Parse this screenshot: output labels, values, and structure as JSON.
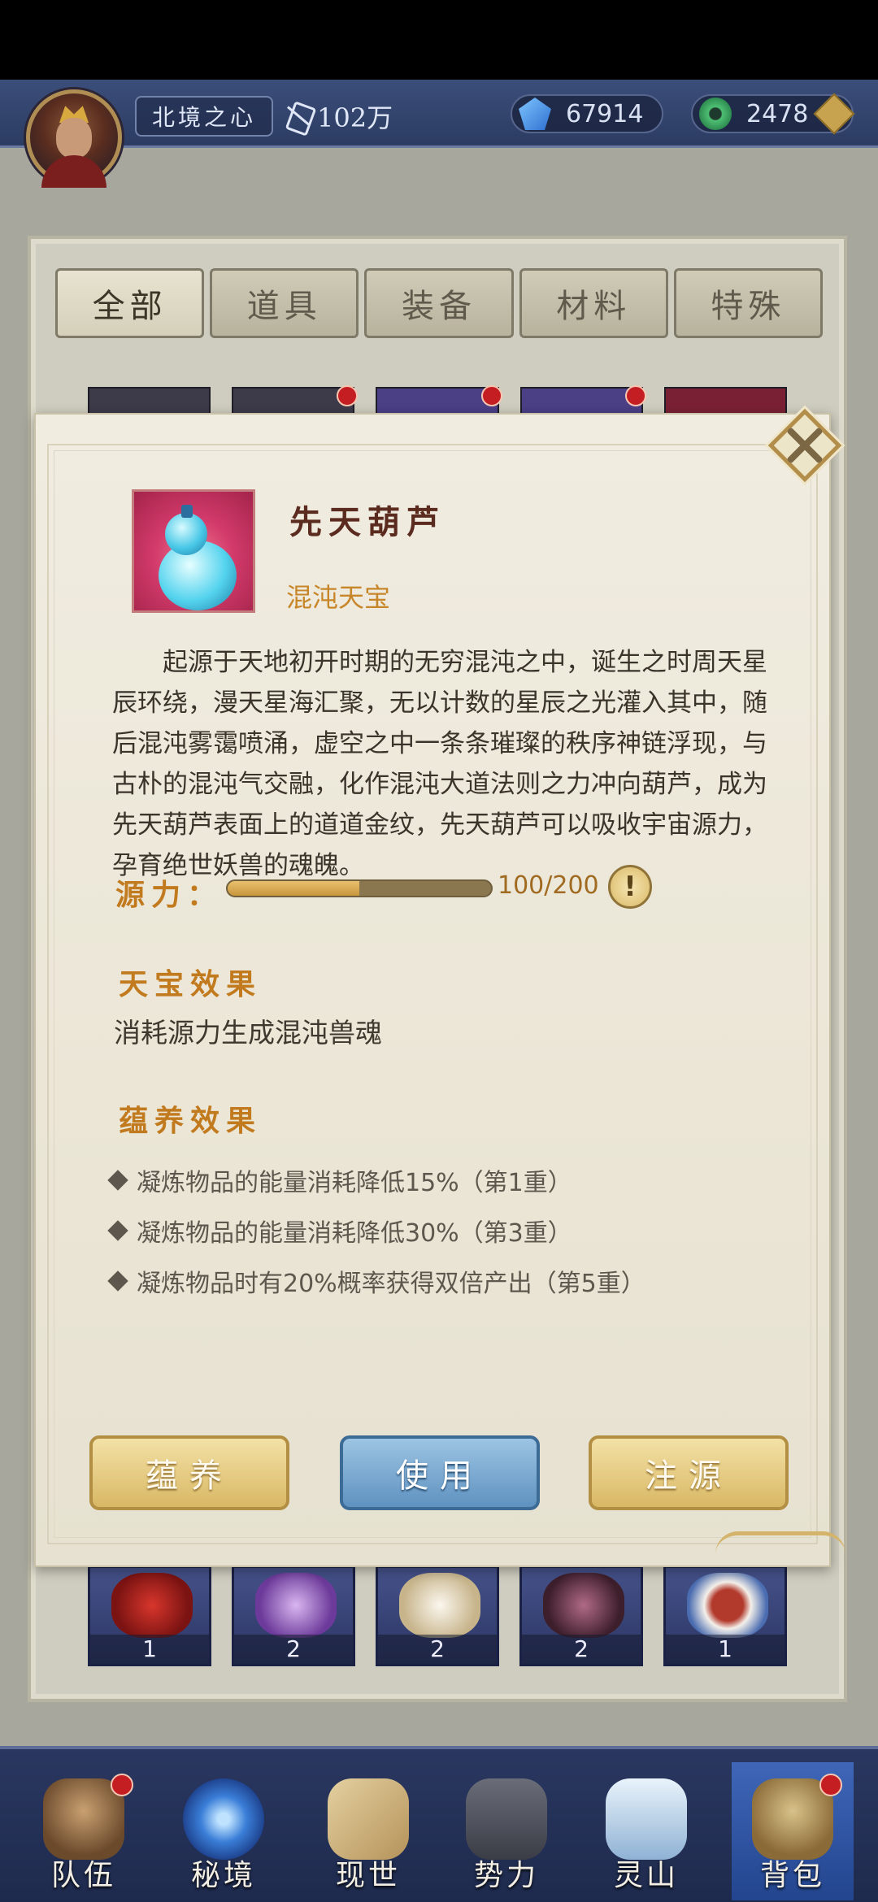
{
  "header": {
    "region": "北境之心",
    "power": "102万",
    "crystal": "67914",
    "jade": "2478"
  },
  "tabs": [
    {
      "label": "全部",
      "active": true
    },
    {
      "label": "道具",
      "active": false
    },
    {
      "label": "装备",
      "active": false
    },
    {
      "label": "材料",
      "active": false
    },
    {
      "label": "特殊",
      "active": false
    }
  ],
  "inventory_bottom": [
    {
      "count": "1",
      "icon": "red-staff-icon"
    },
    {
      "count": "2",
      "icon": "purple-armor-icon"
    },
    {
      "count": "2",
      "icon": "white-robe-icon"
    },
    {
      "count": "2",
      "icon": "dark-helmet-icon"
    },
    {
      "count": "1",
      "icon": "food-bowl-icon"
    }
  ],
  "item": {
    "name": "先天葫芦",
    "type": "混沌天宝",
    "description": "起源于天地初开时期的无穷混沌之中，诞生之时周天星辰环绕，漫天星海汇聚，无以计数的星辰之光灌入其中，随后混沌雾霭喷涌，虚空之中一条条璀璨的秩序神链浮现，与古朴的混沌气交融，化作混沌大道法则之力冲向葫芦，成为先天葫芦表面上的道道金纹，先天葫芦可以吸收宇宙源力，孕育绝世妖兽的魂魄。",
    "source_label": "源力：",
    "source_text": "100/200",
    "source_progress": 0.5,
    "effect_title": "天宝效果",
    "effect_text": "消耗源力生成混沌兽魂",
    "nourish_title": "蕴养效果",
    "nourish_effects": [
      "凝炼物品的能量消耗降低15%（第1重）",
      "凝炼物品的能量消耗降低30%（第3重）",
      "凝炼物品时有20%概率获得双倍产出（第5重）"
    ],
    "info_glyph": "!",
    "buttons": {
      "nourish": "蕴养",
      "use": "使用",
      "inject": "注源"
    }
  },
  "nav": [
    {
      "label": "队伍",
      "icon": "team-icon"
    },
    {
      "label": "秘境",
      "icon": "secret-realm-icon"
    },
    {
      "label": "现世",
      "icon": "world-map-icon"
    },
    {
      "label": "势力",
      "icon": "faction-icon"
    },
    {
      "label": "灵山",
      "icon": "spirit-mountain-icon"
    },
    {
      "label": "背包",
      "icon": "backpack-icon"
    }
  ],
  "colors": {
    "accent_orange": "#c27a1f",
    "title_brown": "#5a2b1e",
    "badge_red": "#c41d22"
  }
}
